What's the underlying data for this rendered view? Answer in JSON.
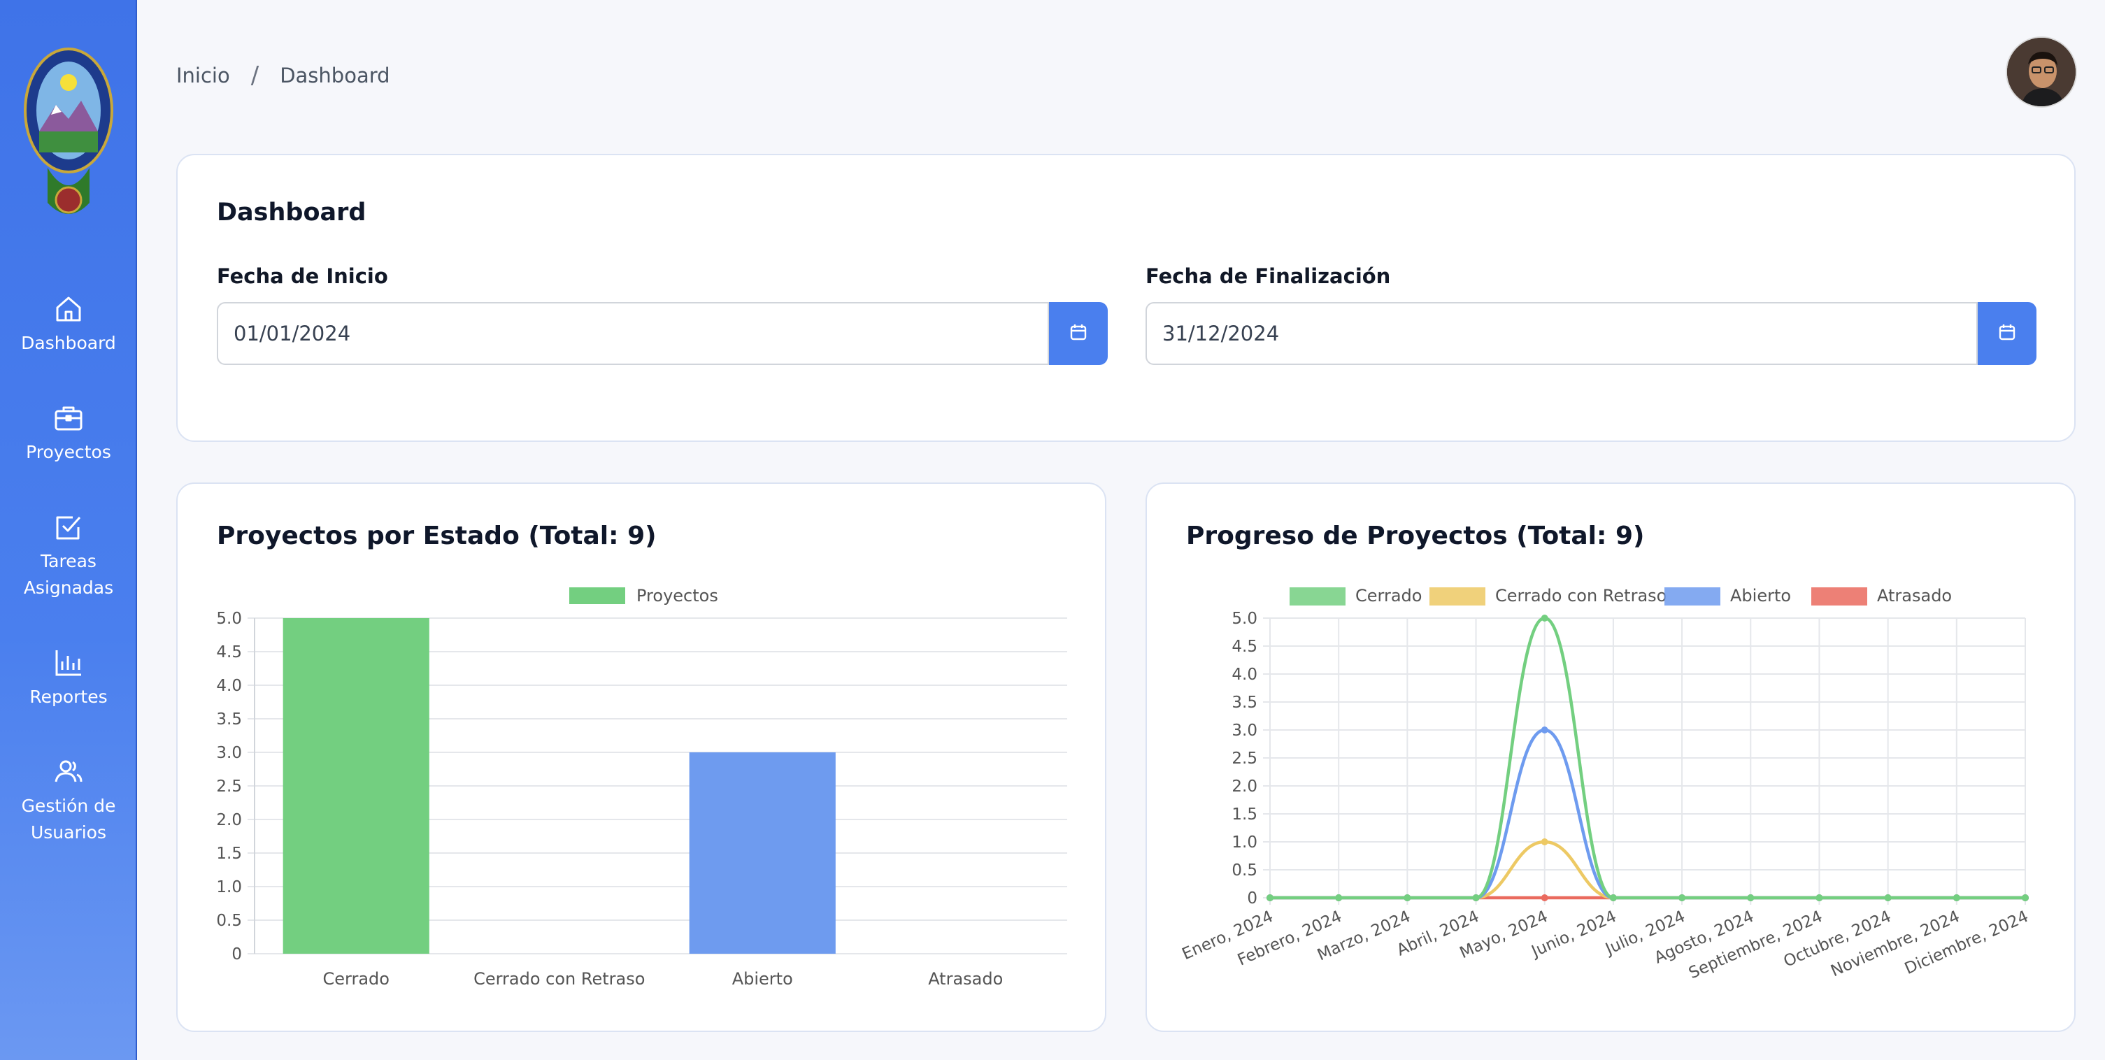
{
  "breadcrumb": {
    "home": "Inicio",
    "separator": "/",
    "current": "Dashboard"
  },
  "sidebar": {
    "items": [
      {
        "label": "Dashboard",
        "icon": "home-icon"
      },
      {
        "label": "Proyectos",
        "icon": "briefcase-icon"
      },
      {
        "label": "Tareas Asignadas",
        "icon": "checkbox-icon"
      },
      {
        "label": "Reportes",
        "icon": "bar-chart-icon"
      },
      {
        "label": "Gestión de Usuarios",
        "icon": "users-icon"
      }
    ]
  },
  "filters": {
    "title": "Dashboard",
    "start_label": "Fecha de Inicio",
    "start_value": "01/01/2024",
    "end_label": "Fecha de Finalización",
    "end_value": "31/12/2024"
  },
  "colors": {
    "accent": "#4a7fee",
    "cerrado": "#73cf80",
    "cerrado_retraso": "#edc964",
    "abierto": "#6e9bef",
    "atrasado": "#ea6a5e"
  },
  "bar_chart_title": "Proyectos por Estado (Total: 9)",
  "line_chart_title": "Progreso de Proyectos (Total: 9)",
  "chart_data": [
    {
      "type": "bar",
      "categories": [
        "Cerrado",
        "Cerrado con Retraso",
        "Abierto",
        "Atrasado"
      ],
      "series": [
        {
          "name": "Proyectos",
          "values": [
            5,
            0,
            3,
            0
          ]
        }
      ],
      "bar_colors": [
        "#73cf80",
        "#edc964",
        "#6e9bef",
        "#ea6a5e"
      ],
      "ylim": [
        0,
        5
      ],
      "yticks": [
        "0",
        "0.5",
        "1.0",
        "1.5",
        "2.0",
        "2.5",
        "3.0",
        "3.5",
        "4.0",
        "4.5",
        "5.0"
      ],
      "legend": "top-center",
      "grid": true
    },
    {
      "type": "line",
      "categories": [
        "Enero, 2024",
        "Febrero, 2024",
        "Marzo, 2024",
        "Abril, 2024",
        "Mayo, 2024",
        "Junio, 2024",
        "Julio, 2024",
        "Agosto, 2024",
        "Septiembre, 2024",
        "Octubre, 2024",
        "Noviembre, 2024",
        "Diciembre, 2024"
      ],
      "series": [
        {
          "name": "Cerrado",
          "color": "#73cf80",
          "values": [
            0,
            0,
            0,
            0,
            5,
            0,
            0,
            0,
            0,
            0,
            0,
            0
          ]
        },
        {
          "name": "Cerrado con Retraso",
          "color": "#edc964",
          "values": [
            0,
            0,
            0,
            0,
            1,
            0,
            0,
            0,
            0,
            0,
            0,
            0
          ]
        },
        {
          "name": "Abierto",
          "color": "#6e9bef",
          "values": [
            0,
            0,
            0,
            0,
            3,
            0,
            0,
            0,
            0,
            0,
            0,
            0
          ]
        },
        {
          "name": "Atrasado",
          "color": "#ea6a5e",
          "values": [
            0,
            0,
            0,
            0,
            0,
            0,
            0,
            0,
            0,
            0,
            0,
            0
          ]
        }
      ],
      "ylim": [
        0,
        5
      ],
      "yticks": [
        "0",
        "0.5",
        "1.0",
        "1.5",
        "2.0",
        "2.5",
        "3.0",
        "3.5",
        "4.0",
        "4.5",
        "5.0"
      ],
      "legend": "top-center",
      "grid": true
    }
  ]
}
